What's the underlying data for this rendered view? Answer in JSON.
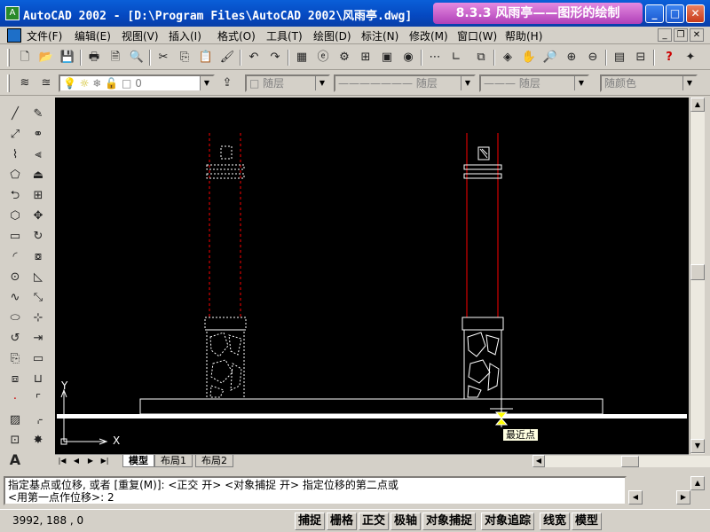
{
  "window": {
    "title": "AutoCAD 2002 - [D:\\Program Files\\AutoCAD 2002\\风雨亭.dwg]",
    "lesson_banner": "8.3.3 风雨亭——图形的绘制",
    "minimize": "_",
    "maximize": "□",
    "close": "✕"
  },
  "menu": {
    "items": [
      "文件(F)",
      "编辑(E)",
      "视图(V)",
      "插入(I)",
      "格式(O)",
      "工具(T)",
      "绘图(D)",
      "标注(N)",
      "修改(M)",
      "窗口(W)",
      "帮助(H)"
    ],
    "mdi_min": "_",
    "mdi_restore": "❐",
    "mdi_close": "✕"
  },
  "layers": {
    "current_layer": "0",
    "color": "随层",
    "linetype": "——————— 随层",
    "lineweight": "——— 随层",
    "plotstyle": "随颜色"
  },
  "drawing": {
    "snap_tooltip": "最近点",
    "ucs_x": "X",
    "ucs_y": "Y"
  },
  "tabs": [
    "模型",
    "布局1",
    "布局2"
  ],
  "command": {
    "line1": "指定基点或位移, 或者 [重复(M)]:  <正交 开>  <对象捕捉 开> 指定位移的第二点或",
    "line2": "<用第一点作位移>: 2"
  },
  "status": {
    "coords": "3992, 188 , 0",
    "buttons": [
      "捕捉",
      "栅格",
      "正交",
      "极轴",
      "对象捕捉",
      "对象追踪",
      "线宽",
      "模型"
    ]
  }
}
